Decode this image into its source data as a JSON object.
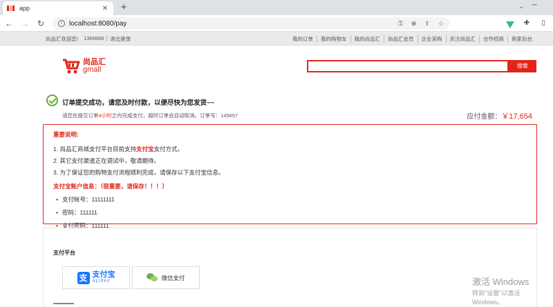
{
  "browser": {
    "tab_title": "app",
    "url": "localhost:8080/pay"
  },
  "site_bar": {
    "welcome": "尚品汇欢迎您!",
    "user": "1366666",
    "logout": "退出登录",
    "links": [
      "我的订单",
      "我的购物车",
      "我的尚品汇",
      "尚品汇会员",
      "企业采购",
      "关注尚品汇",
      "合作招商",
      "商家后台"
    ]
  },
  "header": {
    "logo_cn": "尚品汇",
    "logo_en": "gmall",
    "search_value": "",
    "search_button": "搜索"
  },
  "success": {
    "title": "订单提交成功，请您及时付款，以便尽快为您发货~~",
    "sub_prefix": "请您在提交订单",
    "sub_highlight": "4小时",
    "sub_middle": "之内完成支付，超时订单会自动取消。订单号：",
    "order_no": "145657",
    "amount_label": "应付金额：",
    "amount_value": "￥17,654"
  },
  "notice": {
    "heading": "重要说明:",
    "items": [
      {
        "pre": "1. 尚品汇商城支付平台目前支持",
        "hl": "支付宝",
        "post": "支付方式。"
      },
      {
        "pre": "2. 其它支付渠道正在调试中，敬请期待。",
        "hl": "",
        "post": ""
      },
      {
        "pre": "3. 为了保证您的购物支付流程顺利完成，请保存以下支付宝信息。",
        "hl": "",
        "post": ""
      }
    ],
    "account_heading": "支付宝账户信息：（很重要，请保存！！！）",
    "account_items": [
      "支付帐号：11111111",
      "密码：111111",
      "支付密码：111111"
    ]
  },
  "platform": {
    "title": "支付平台",
    "alipay_cn": "支付宝",
    "alipay_en": "ALIPAY",
    "wechat": "微信支付"
  },
  "watermark": {
    "title": "激活 Windows",
    "sub": "转到\"设置\"以激活 Windows。"
  },
  "colors": {
    "brand_red": "#e1251b",
    "success_green": "#5cb031",
    "alipay_blue": "#1677ff"
  }
}
